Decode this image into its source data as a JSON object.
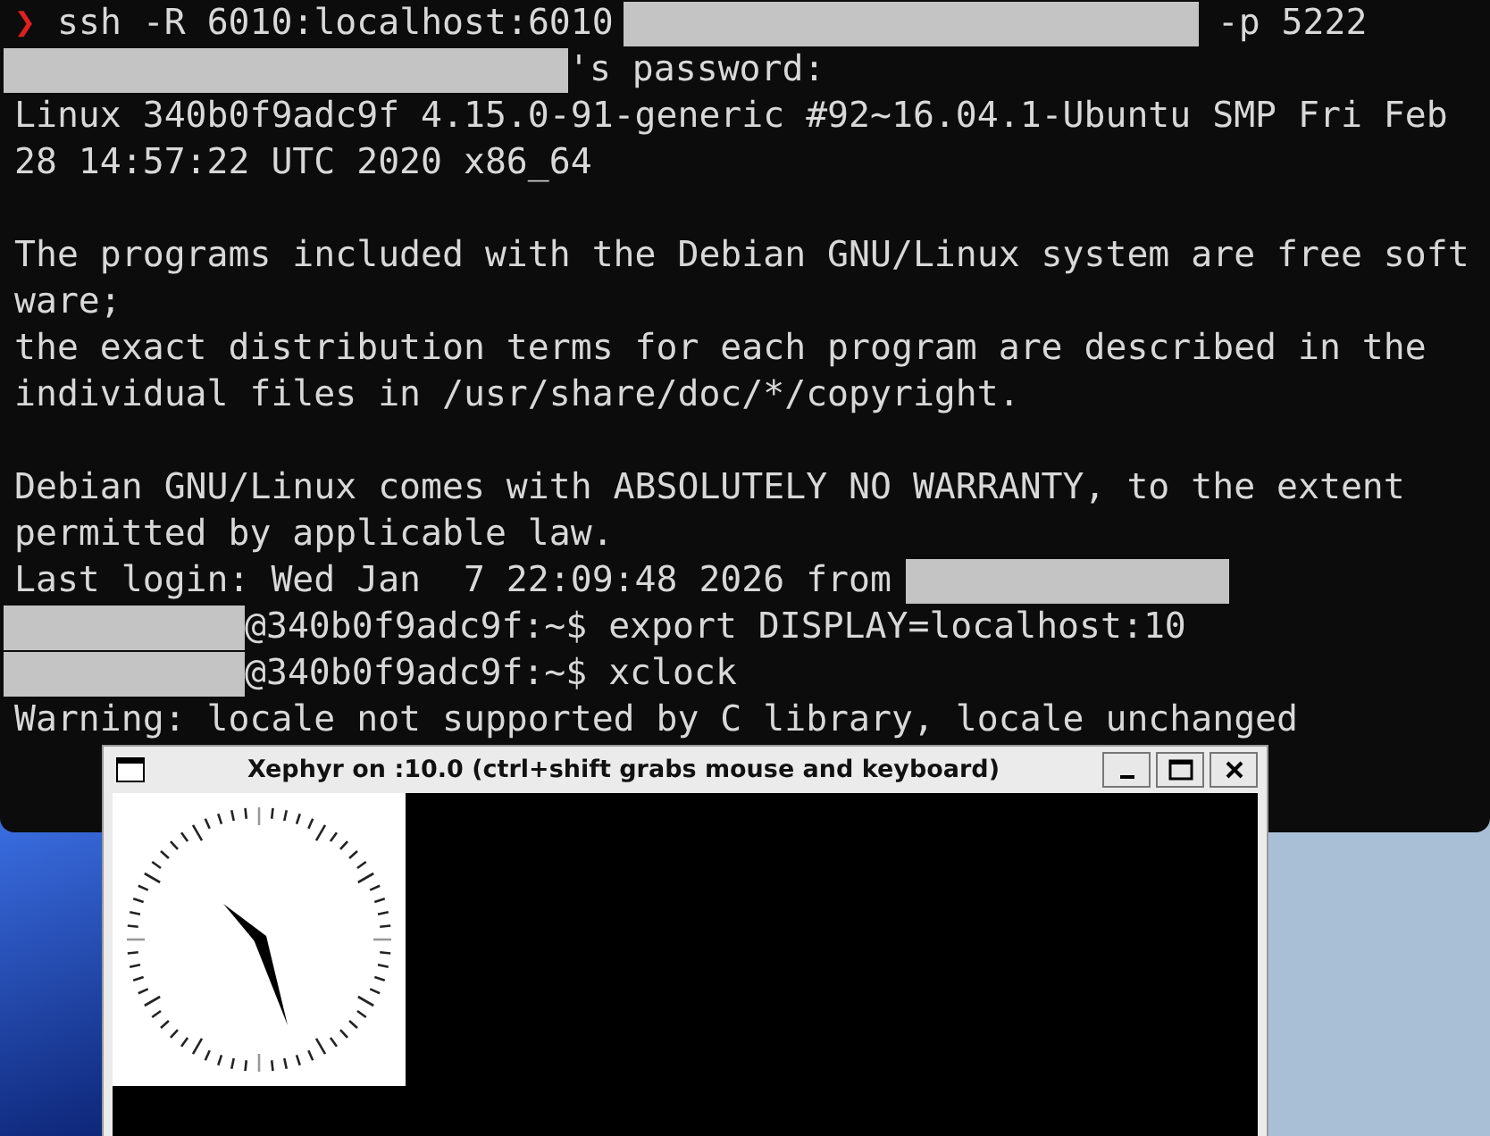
{
  "terminal": {
    "lines": [
      {
        "kind": "output",
        "parts": [
          {
            "kind": "prompt",
            "text": "❯"
          },
          {
            "kind": "text",
            "text": "ssh -R 6010:localhost:6010"
          },
          {
            "kind": "redacted"
          },
          {
            "kind": "text",
            "text": "-p 5222"
          }
        ]
      },
      {
        "kind": "output",
        "parts": [
          {
            "kind": "redacted"
          },
          {
            "kind": "text",
            "text": "'s password:"
          }
        ]
      },
      {
        "kind": "output",
        "parts": [
          {
            "kind": "text",
            "text": "Linux 340b0f9adc9f 4.15.0-91-generic #92~16.04.1-Ubuntu SMP Fri Feb"
          }
        ]
      },
      {
        "kind": "output",
        "parts": [
          {
            "kind": "text",
            "text": "28 14:57:22 UTC 2020 x86_64"
          }
        ]
      },
      {
        "kind": "blank"
      },
      {
        "kind": "output",
        "parts": [
          {
            "kind": "text",
            "text": "The programs included with the Debian GNU/Linux system are free soft"
          }
        ]
      },
      {
        "kind": "output",
        "parts": [
          {
            "kind": "text",
            "text": "ware;"
          }
        ]
      },
      {
        "kind": "output",
        "parts": [
          {
            "kind": "text",
            "text": "the exact distribution terms for each program are described in the"
          }
        ]
      },
      {
        "kind": "output",
        "parts": [
          {
            "kind": "text",
            "text": "individual files in /usr/share/doc/*/copyright."
          }
        ]
      },
      {
        "kind": "blank"
      },
      {
        "kind": "output",
        "parts": [
          {
            "kind": "text",
            "text": "Debian GNU/Linux comes with ABSOLUTELY NO WARRANTY, to the extent"
          }
        ]
      },
      {
        "kind": "output",
        "parts": [
          {
            "kind": "text",
            "text": "permitted by applicable law."
          }
        ]
      },
      {
        "kind": "output",
        "parts": [
          {
            "kind": "text",
            "text": "Last login: Wed Jan  7 22:09:48 2026 from"
          },
          {
            "kind": "redacted"
          }
        ]
      },
      {
        "kind": "output",
        "parts": [
          {
            "kind": "redacted"
          },
          {
            "kind": "text",
            "text": "@340b0f9adc9f:~$ export DISPLAY=localhost:10"
          }
        ]
      },
      {
        "kind": "output",
        "parts": [
          {
            "kind": "redacted"
          },
          {
            "kind": "text",
            "text": "@340b0f9adc9f:~$ xclock"
          }
        ]
      },
      {
        "kind": "output",
        "parts": [
          {
            "kind": "text",
            "text": "Warning: locale not supported by C library, locale unchanged"
          }
        ]
      }
    ]
  },
  "xephyr_window": {
    "title": "Xephyr on :10.0 (ctrl+shift grabs mouse and keyboard)"
  }
}
